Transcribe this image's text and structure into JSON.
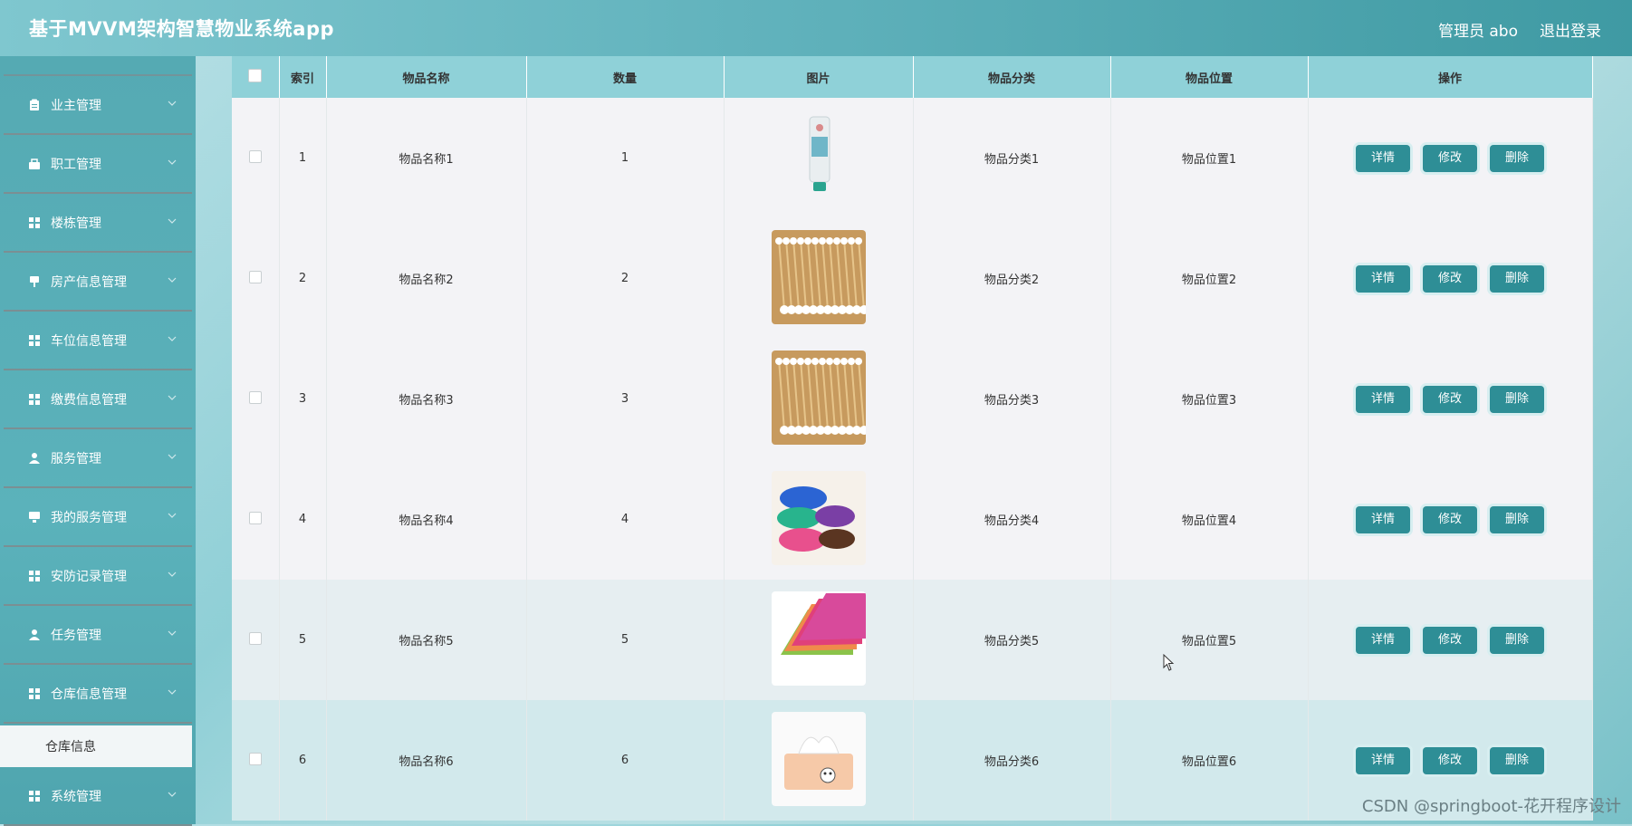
{
  "header": {
    "title": "基于MVVM架构智慧物业系统app",
    "user_label": "管理员 abo",
    "logout_label": "退出登录"
  },
  "sidebar": {
    "items": [
      {
        "label": "业主管理",
        "icon": "clipboard-icon"
      },
      {
        "label": "职工管理",
        "icon": "briefcase-icon"
      },
      {
        "label": "楼栋管理",
        "icon": "grid-icon"
      },
      {
        "label": "房产信息管理",
        "icon": "sign-icon"
      },
      {
        "label": "车位信息管理",
        "icon": "grid-icon"
      },
      {
        "label": "缴费信息管理",
        "icon": "grid-icon"
      },
      {
        "label": "服务管理",
        "icon": "user-icon"
      },
      {
        "label": "我的服务管理",
        "icon": "monitor-icon"
      },
      {
        "label": "安防记录管理",
        "icon": "grid-icon"
      },
      {
        "label": "任务管理",
        "icon": "user-icon"
      },
      {
        "label": "仓库信息管理",
        "icon": "grid-icon"
      }
    ],
    "active_submenu": "仓库信息",
    "last_item": {
      "label": "系统管理",
      "icon": "grid-icon"
    }
  },
  "table": {
    "columns": [
      "索引",
      "物品名称",
      "数量",
      "图片",
      "物品分类",
      "物品位置",
      "操作"
    ],
    "rows": [
      {
        "index": "1",
        "name": "物品名称1",
        "qty": "1",
        "image": "toothpaste",
        "category": "物品分类1",
        "location": "物品位置1"
      },
      {
        "index": "2",
        "name": "物品名称2",
        "qty": "2",
        "image": "cotton-swabs",
        "category": "物品分类2",
        "location": "物品位置2"
      },
      {
        "index": "3",
        "name": "物品名称3",
        "qty": "3",
        "image": "cotton-swabs",
        "category": "物品分类3",
        "location": "物品位置3"
      },
      {
        "index": "4",
        "name": "物品名称4",
        "qty": "4",
        "image": "rolled-towels",
        "category": "物品分类4",
        "location": "物品位置4"
      },
      {
        "index": "5",
        "name": "物品名称5",
        "qty": "5",
        "image": "folded-cloths",
        "category": "物品分类5",
        "location": "物品位置5"
      },
      {
        "index": "6",
        "name": "物品名称6",
        "qty": "6",
        "image": "tissue-box",
        "category": "物品分类6",
        "location": "物品位置6"
      }
    ],
    "actions": {
      "detail": "详情",
      "edit": "修改",
      "delete": "删除"
    }
  },
  "watermark": "CSDN @springboot-花开程序设计",
  "colors": {
    "accent": "#2e8e96",
    "header_row": "#8fd1d8"
  }
}
